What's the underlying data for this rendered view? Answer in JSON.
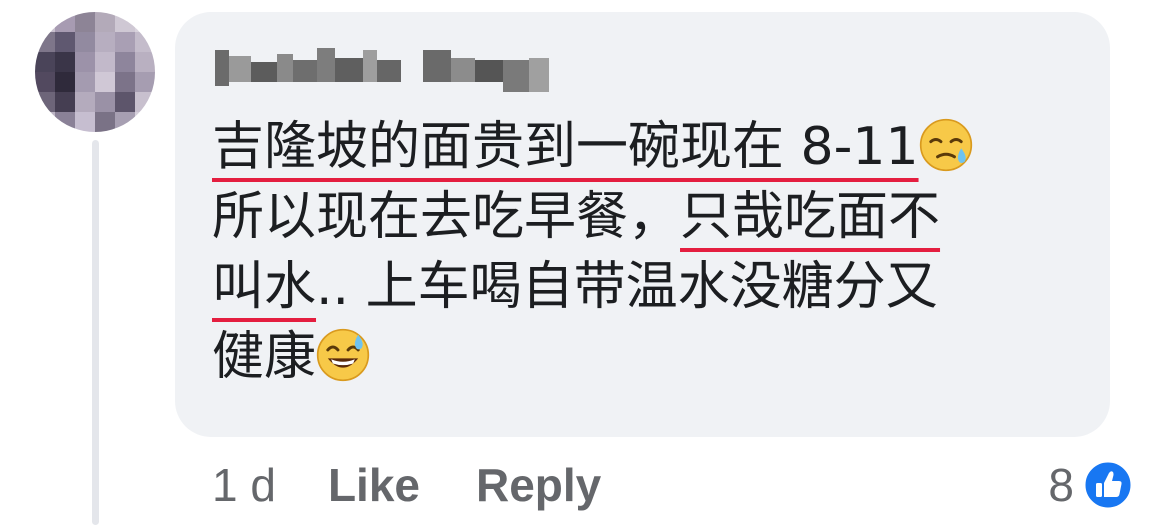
{
  "comment": {
    "author_name": "",
    "line1_part1": "吉隆坡的面贵到一碗现在 8-11",
    "line2_part1": "所以现在去吃早餐，",
    "line2_highlight": "只哉吃面不",
    "line3_highlight": "叫水",
    "line3_rest": ".. 上车喝自带温水没糖分又",
    "line4": "健康",
    "emoji_1": "sad-sweat-face-emoji",
    "emoji_2": "grinning-sweat-face-emoji"
  },
  "actions": {
    "time": "1 d",
    "like_label": "Like",
    "reply_label": "Reply"
  },
  "reactions": {
    "count": "8",
    "icon": "like-thumbs-up-icon"
  },
  "colors": {
    "bubble_bg": "#f0f2f5",
    "text": "#1c1e21",
    "muted": "#65676b",
    "underline": "#e41e3f",
    "like_blue": "#1877f2"
  }
}
